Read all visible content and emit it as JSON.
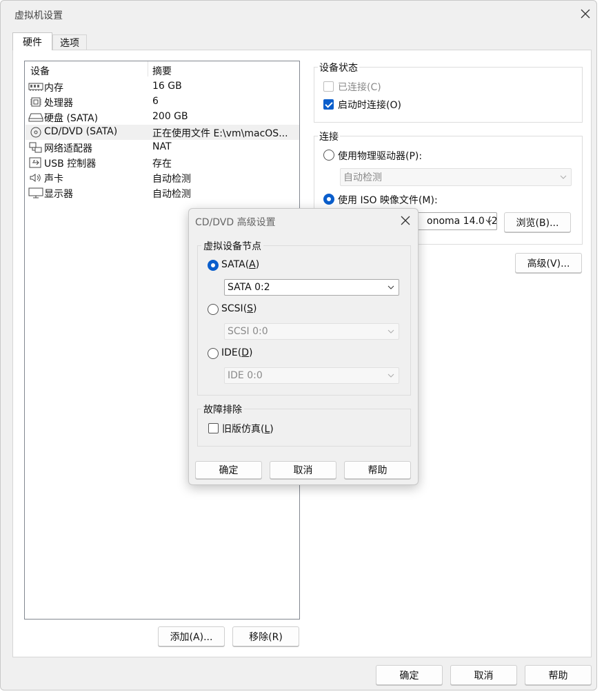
{
  "window": {
    "title": "虚拟机设置",
    "tabs": [
      {
        "label": "硬件"
      },
      {
        "label": "选项"
      }
    ]
  },
  "device_list": {
    "headers": {
      "device": "设备",
      "summary": "摘要"
    },
    "rows": [
      {
        "icon": "memory-icon",
        "device": "内存",
        "summary": "16 GB"
      },
      {
        "icon": "processor-icon",
        "device": "处理器",
        "summary": "6"
      },
      {
        "icon": "hard-disk-icon",
        "device": "硬盘 (SATA)",
        "summary": "200 GB"
      },
      {
        "icon": "cd-dvd-icon",
        "device": "CD/DVD (SATA)",
        "summary": "正在使用文件 E:\\vm\\macOS..."
      },
      {
        "icon": "network-adapter-icon",
        "device": "网络适配器",
        "summary": "NAT"
      },
      {
        "icon": "usb-icon",
        "device": "USB 控制器",
        "summary": "存在"
      },
      {
        "icon": "sound-card-icon",
        "device": "声卡",
        "summary": "自动检测"
      },
      {
        "icon": "display-icon",
        "device": "显示器",
        "summary": "自动检测"
      }
    ],
    "selected_index": 3,
    "add_button": "添加(A)...",
    "remove_button": "移除(R)"
  },
  "device_status": {
    "title": "设备状态",
    "connected_label": "已连接(C)",
    "connected_checked": false,
    "connected_enabled": false,
    "connect_on_power_on_label": "启动时连接(O)",
    "connect_on_power_on_checked": true
  },
  "connection": {
    "title": "连接",
    "physical_drive_label": "使用物理驱动器(P):",
    "physical_drive_selected": false,
    "physical_drive_value": "自动检测",
    "iso_label": "使用 ISO 映像文件(M):",
    "iso_selected": true,
    "iso_value_visible": "onoma 14.0 (2",
    "browse_button": "浏览(B)..."
  },
  "advanced_button": "高级(V)...",
  "footer": {
    "ok": "确定",
    "cancel": "取消",
    "help": "帮助"
  },
  "dialog": {
    "title": "CD/DVD 高级设置",
    "node_group_title": "虚拟设备节点",
    "options": [
      {
        "label": "SATA",
        "key": "A",
        "selected": true,
        "select_value": "SATA 0:2",
        "enabled": true
      },
      {
        "label": "SCSI",
        "key": "S",
        "selected": false,
        "select_value": "SCSI 0:0",
        "enabled": false
      },
      {
        "label": "IDE",
        "key": "D",
        "selected": false,
        "select_value": "IDE 0:0",
        "enabled": false
      }
    ],
    "troubleshoot_title": "故障排除",
    "legacy_label": "旧版仿真",
    "legacy_key": "L",
    "legacy_checked": false,
    "ok": "确定",
    "cancel": "取消",
    "help": "帮助"
  },
  "colors": {
    "accent": "#0a5ecc",
    "window_bg": "#f0f0f0",
    "panel_bg": "#ffffff"
  }
}
